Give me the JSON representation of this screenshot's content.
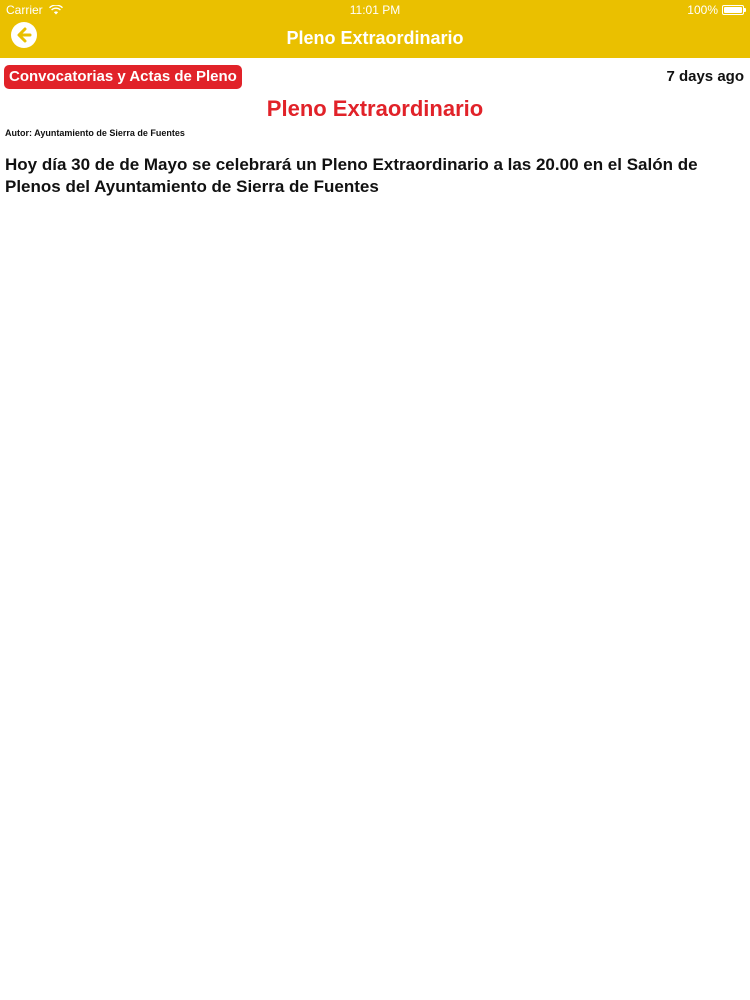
{
  "status_bar": {
    "carrier": "Carrier",
    "time": "11:01 PM",
    "battery": "100%"
  },
  "nav": {
    "title": "Pleno Extraordinario",
    "back_icon": "arrow-left-circle-icon"
  },
  "article": {
    "category": "Convocatorias y Actas de Pleno",
    "age": "7 days ago",
    "title": "Pleno Extraordinario",
    "author": "Autor: Ayuntamiento de Sierra de Fuentes",
    "body": "Hoy día 30 de de Mayo se celebrará un Pleno Extraordinario a las 20.00 en el Salón de Plenos del Ayuntamiento de Sierra de Fuentes"
  },
  "colors": {
    "header_yellow": "#EAC000",
    "accent_red": "#E12229",
    "text_dark": "#111111"
  }
}
